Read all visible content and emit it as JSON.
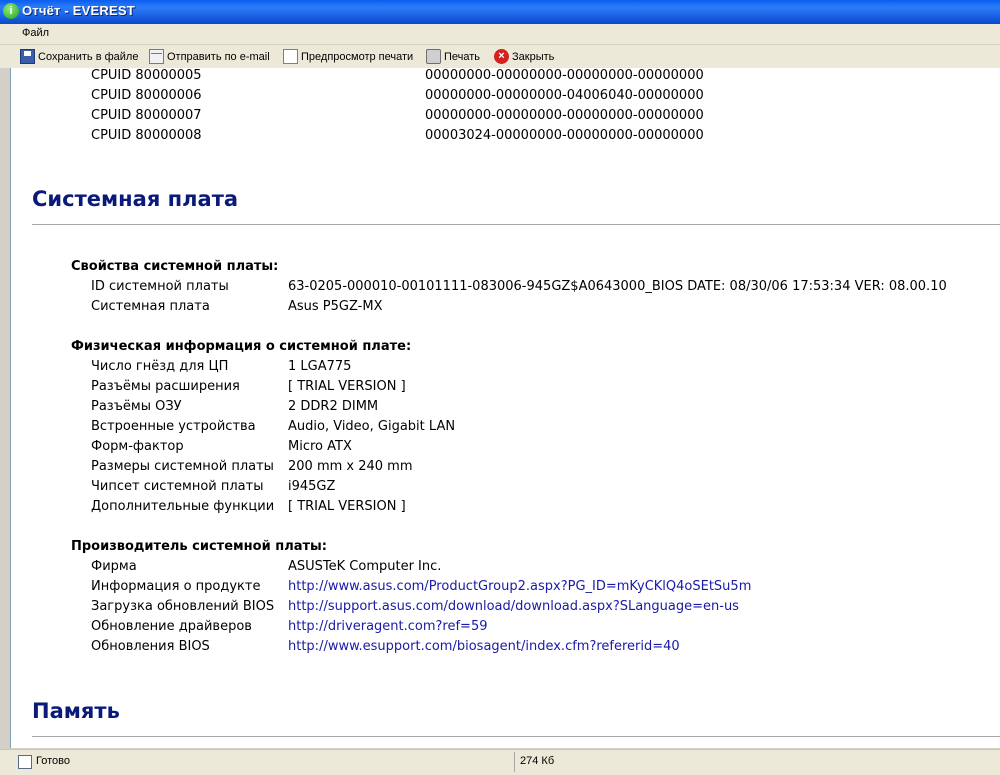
{
  "window": {
    "title": "Отчёт - EVEREST"
  },
  "menu": {
    "file": "Файл"
  },
  "toolbar": {
    "save": "Сохранить в файле",
    "email": "Отправить по e-mail",
    "preview": "Предпросмотр печати",
    "print": "Печать",
    "close": "Закрыть"
  },
  "cpuid_rows": [
    {
      "label": "CPUID 80000005",
      "value": "00000000-00000000-00000000-00000000"
    },
    {
      "label": "CPUID 80000006",
      "value": "00000000-00000000-04006040-00000000"
    },
    {
      "label": "CPUID 80000007",
      "value": "00000000-00000000-00000000-00000000"
    },
    {
      "label": "CPUID 80000008",
      "value": "00003024-00000000-00000000-00000000"
    }
  ],
  "section_motherboard": "Системная плата",
  "props": {
    "title": "Свойства системной платы:",
    "rows": [
      {
        "label": "ID системной платы",
        "value": "63-0205-000010-00101111-083006-945GZ$A0643000_BIOS DATE: 08/30/06 17:53:34 VER: 08.00.10"
      },
      {
        "label": "Системная плата",
        "value": "Asus P5GZ-MX"
      }
    ]
  },
  "physical": {
    "title": "Физическая информация о системной плате:",
    "rows": [
      {
        "label": "Число гнёзд для ЦП",
        "value": "1 LGA775"
      },
      {
        "label": "Разъёмы расширения",
        "value": "[ TRIAL VERSION ]"
      },
      {
        "label": "Разъёмы ОЗУ",
        "value": "2 DDR2 DIMM"
      },
      {
        "label": "Встроенные устройства",
        "value": "Audio, Video, Gigabit LAN"
      },
      {
        "label": "Форм-фактор",
        "value": "Micro ATX"
      },
      {
        "label": "Размеры системной платы",
        "value": "200 mm x 240 mm"
      },
      {
        "label": "Чипсет системной платы",
        "value": "i945GZ"
      },
      {
        "label": "Дополнительные функции",
        "value": "[ TRIAL VERSION ]"
      }
    ]
  },
  "maker": {
    "title": "Производитель системной платы:",
    "rows": [
      {
        "label": "Фирма",
        "value": "ASUSTeK Computer Inc."
      },
      {
        "label": "Информация о продукте",
        "value": "http://www.asus.com/ProductGroup2.aspx?PG_ID=mKyCKlQ4oSEtSu5m"
      },
      {
        "label": "Загрузка обновлений BIOS",
        "value": "http://support.asus.com/download/download.aspx?SLanguage=en-us"
      },
      {
        "label": "Обновление драйверов",
        "value": "http://driveragent.com?ref=59"
      },
      {
        "label": "Обновления BIOS",
        "value": "http://www.esupport.com/biosagent/index.cfm?refererid=40"
      }
    ]
  },
  "section_memory": "Память",
  "status": {
    "text": "Готово",
    "size": "274 Кб"
  }
}
